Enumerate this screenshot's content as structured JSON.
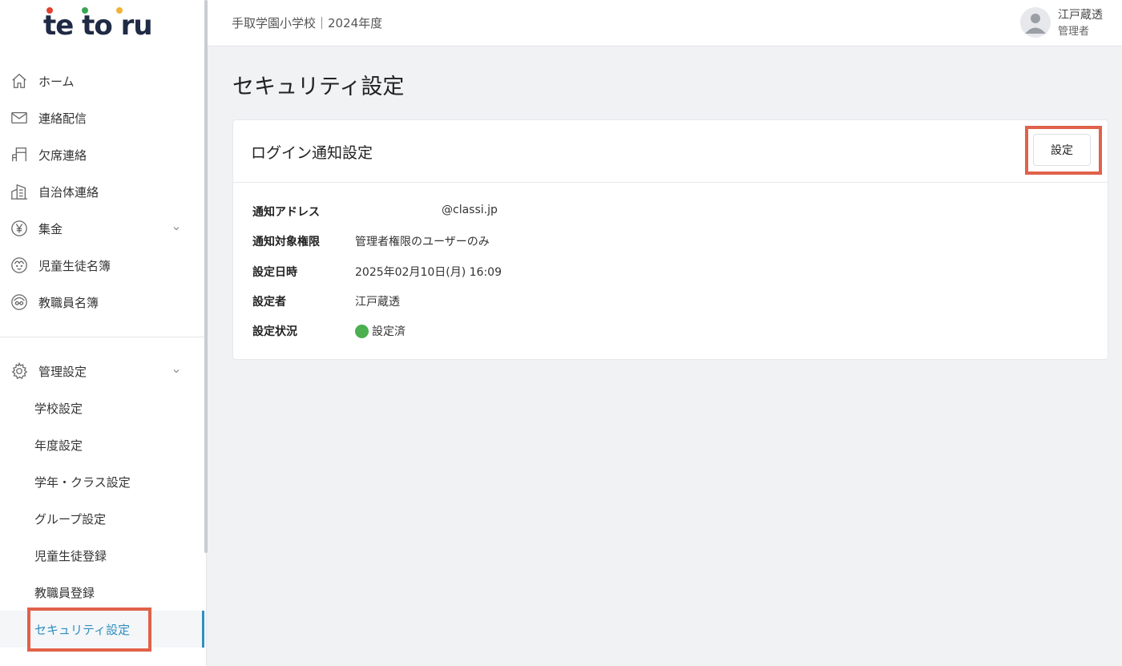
{
  "brand": {
    "logo_text": "te to ru",
    "dot_colors": [
      "#e2432f",
      "#3aa655",
      "#f2b233"
    ]
  },
  "header": {
    "school": "手取学園小学校｜2024年度",
    "user_name": "江戸蔵透",
    "user_role": "管理者"
  },
  "sidebar": {
    "items": [
      {
        "label": "ホーム",
        "icon": "home-icon"
      },
      {
        "label": "連絡配信",
        "icon": "mail-icon"
      },
      {
        "label": "欠席連絡",
        "icon": "desk-icon"
      },
      {
        "label": "自治体連絡",
        "icon": "building-icon"
      },
      {
        "label": "集金",
        "icon": "yen-icon",
        "expandable": true
      },
      {
        "label": "児童生徒名簿",
        "icon": "child-face-icon"
      },
      {
        "label": "教職員名簿",
        "icon": "teacher-face-icon"
      }
    ],
    "admin": {
      "label": "管理設定",
      "icon": "gear-icon",
      "sub_items": [
        {
          "label": "学校設定"
        },
        {
          "label": "年度設定"
        },
        {
          "label": "学年・クラス設定"
        },
        {
          "label": "グループ設定"
        },
        {
          "label": "児童生徒登録"
        },
        {
          "label": "教職員登録"
        },
        {
          "label": "セキュリティ設定",
          "active": true
        }
      ]
    }
  },
  "main": {
    "title": "セキュリティ設定",
    "card": {
      "title": "ログイン通知設定",
      "button_label": "設定",
      "rows": [
        {
          "label": "通知アドレス",
          "value": "@classi.jp"
        },
        {
          "label": "通知対象権限",
          "value": "管理者権限のユーザーのみ"
        },
        {
          "label": "設定日時",
          "value": "2025年02月10日(月) 16:09"
        },
        {
          "label": "設定者",
          "value": "江戸蔵透"
        },
        {
          "label": "設定状況",
          "value": "設定済",
          "status_color": "#4caf50"
        }
      ]
    }
  },
  "colors": {
    "accent": "#2e8fbf",
    "highlight": "#e0614a"
  }
}
